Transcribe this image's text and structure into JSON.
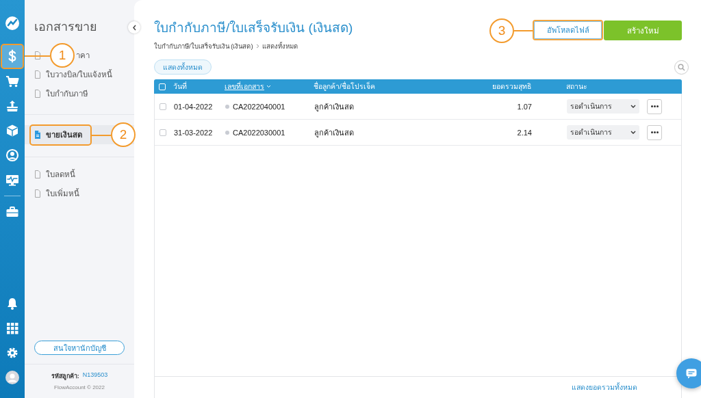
{
  "rail": {
    "nav": [
      {
        "kind": "dollar",
        "selected": true,
        "highlighted": true
      },
      {
        "kind": "cart",
        "selected": false,
        "highlighted": false
      },
      {
        "kind": "upload",
        "selected": false,
        "highlighted": false
      },
      {
        "kind": "box",
        "selected": false,
        "highlighted": false
      },
      {
        "kind": "contact",
        "selected": false,
        "highlighted": false
      },
      {
        "kind": "monitor",
        "selected": false,
        "highlighted": false
      }
    ],
    "extras": [
      {
        "kind": "briefcase",
        "selected": false,
        "highlighted": false
      }
    ],
    "tools": [
      {
        "kind": "bell"
      },
      {
        "kind": "grid"
      },
      {
        "kind": "gear"
      },
      {
        "kind": "avatar"
      }
    ]
  },
  "sidebar": {
    "title": "เอกสารขาย",
    "groups": [
      [
        {
          "label_parts": [
            "าคา"
          ],
          "selected": false,
          "highlighted": false
        },
        {
          "label": "ใบวางบิล/ใบแจ้งหนี้",
          "selected": false,
          "highlighted": false
        },
        {
          "label": "ใบกำกับภาษี",
          "selected": false,
          "highlighted": false
        }
      ],
      [
        {
          "label": "ขายเงินสด",
          "selected": true,
          "highlighted": true
        }
      ],
      [
        {
          "label": "ใบลดหนี้",
          "selected": false,
          "highlighted": false
        },
        {
          "label": "ใบเพิ่มหนี้",
          "selected": false,
          "highlighted": false
        }
      ]
    ],
    "accountant_button": "สนใจหานักบัญชี",
    "customer_label": "รหัสลูกค้า:",
    "customer_id": "N139503",
    "copyright": "FlowAccount © 2022"
  },
  "main": {
    "title": "ใบกำกับภาษี/ใบเสร็จรับเงิน (เงินสด)",
    "breadcrumb": [
      "ใบกำกับภาษี/ใบเสร็จรับเงิน (เงินสด)",
      "แสดงทั้งหมด"
    ],
    "upload_button": "อัพโหลดไฟล์",
    "upload_highlighted": true,
    "create_button": "สร้างใหม่",
    "filter": "แสดงทั้งหมด",
    "table": {
      "select_all": {
        "checked": false
      },
      "columns": [
        {
          "label": "วันที่",
          "sorted": false
        },
        {
          "label": "เลขที่เอกสาร",
          "sorted": true
        },
        {
          "label": "ชื่อลูกค้า/ชื่อโปรเจ็ค",
          "sorted": false
        },
        {
          "label": "ยอดรวมสุทธิ",
          "sorted": false
        },
        {
          "label": "สถานะ",
          "sorted": false
        }
      ],
      "rows": [
        {
          "checked": false,
          "date": "01-04-2022",
          "doc_no": "CA2022040001",
          "customer": "ลูกค้าเงินสด",
          "total": "1.07",
          "status": "รอดำเนินการ"
        },
        {
          "checked": false,
          "date": "31-03-2022",
          "doc_no": "CA2022030001",
          "customer": "ลูกค้าเงินสด",
          "total": "2.14",
          "status": "รอดำเนินการ"
        }
      ],
      "footer": "แสดงยอดรวมทั้งหมด"
    }
  },
  "callouts": [
    {
      "number": "1"
    },
    {
      "number": "2"
    },
    {
      "number": "3"
    }
  ]
}
